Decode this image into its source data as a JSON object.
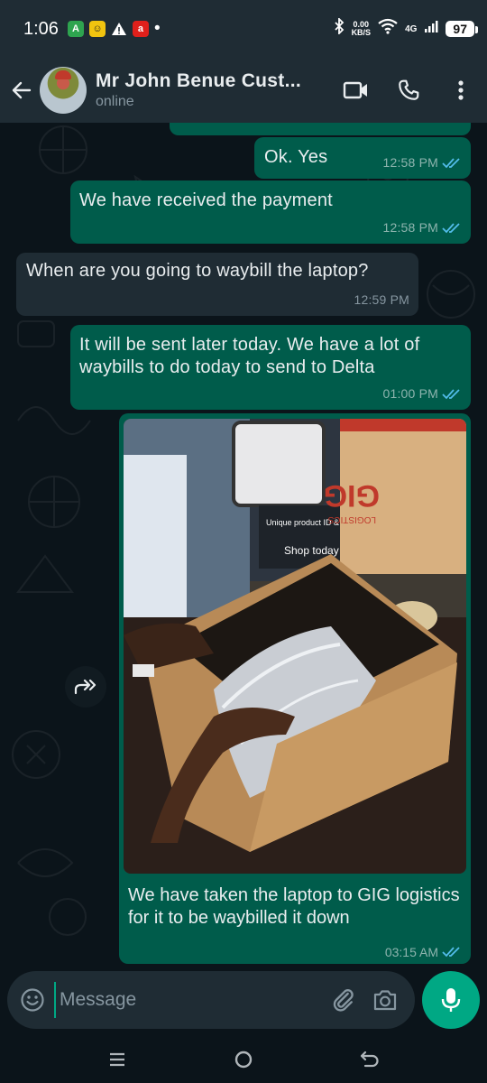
{
  "status_bar": {
    "time": "1:06",
    "speed_top": "0.00",
    "speed_bottom": "KB/S",
    "network": "4G",
    "battery": "97"
  },
  "header": {
    "title": "Mr John Benue Cust...",
    "status": "online",
    "icons": [
      "back-arrow-icon",
      "video-call-icon",
      "voice-call-icon",
      "more-vert-icon"
    ]
  },
  "messages": [
    {
      "direction": "out",
      "text": "Ok. Yes",
      "time": "12:58 PM",
      "read": true
    },
    {
      "direction": "out",
      "text": "We have received the payment",
      "time": "12:58 PM",
      "read": true
    },
    {
      "direction": "in",
      "text": "When are you going to waybill the laptop?",
      "time": "12:59 PM"
    },
    {
      "direction": "out",
      "text": "It will be sent later today. We have a lot of waybills to do today to send to Delta",
      "time": "01:00 PM",
      "read": true
    },
    {
      "direction": "out",
      "type": "image",
      "photo_text": [
        "GIG",
        "LOGISTICS",
        "Unique product ID & QR code",
        "Shop today"
      ],
      "caption": "We have taken the laptop to GIG logistics for it to be waybilled it down",
      "time": "03:15 AM",
      "read": true
    }
  ],
  "composer": {
    "placeholder": "Message",
    "icons": [
      "emoji-icon",
      "attach-icon",
      "camera-icon",
      "mic-icon"
    ]
  },
  "colors": {
    "outgoing_bubble": "#005c4b",
    "incoming_bubble": "#1f2c34",
    "accent": "#00a884",
    "read_ticks": "#53bdeb"
  }
}
